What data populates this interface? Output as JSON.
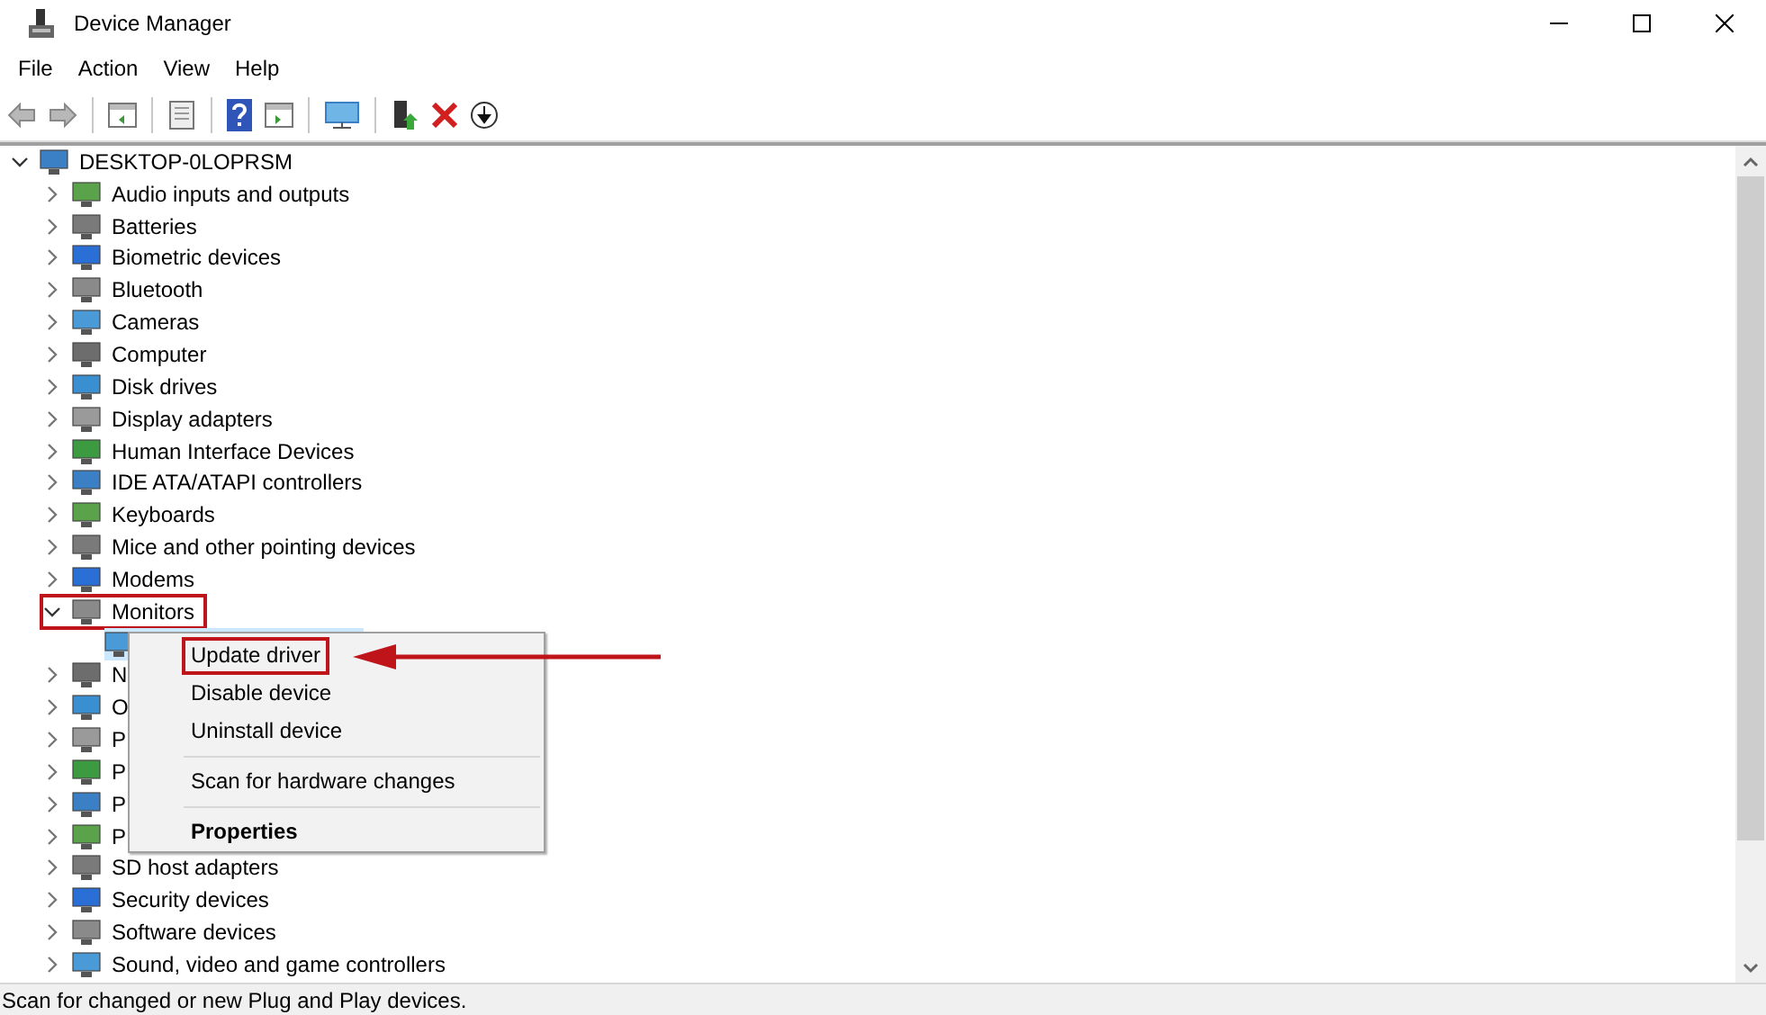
{
  "window": {
    "title": "Device Manager"
  },
  "menu": [
    "File",
    "Action",
    "View",
    "Help"
  ],
  "tree": {
    "label": "DESKTOP-0LOPRSM",
    "expanded": true,
    "selected": false,
    "children": [
      {
        "label": "Audio inputs and outputs",
        "expanded": false,
        "selected": false,
        "callout": false
      },
      {
        "label": "Batteries",
        "expanded": false,
        "selected": false,
        "callout": false
      },
      {
        "label": "Biometric devices",
        "expanded": false,
        "selected": false,
        "callout": false
      },
      {
        "label": "Bluetooth",
        "expanded": false,
        "selected": false,
        "callout": false
      },
      {
        "label": "Cameras",
        "expanded": false,
        "selected": false,
        "callout": false
      },
      {
        "label": "Computer",
        "expanded": false,
        "selected": false,
        "callout": false
      },
      {
        "label": "Disk drives",
        "expanded": false,
        "selected": false,
        "callout": false
      },
      {
        "label": "Display adapters",
        "expanded": false,
        "selected": false,
        "callout": false
      },
      {
        "label": "Human Interface Devices",
        "expanded": false,
        "selected": false,
        "callout": false
      },
      {
        "label": "IDE ATA/ATAPI controllers",
        "expanded": false,
        "selected": false,
        "callout": false
      },
      {
        "label": "Keyboards",
        "expanded": false,
        "selected": false,
        "callout": false
      },
      {
        "label": "Mice and other pointing devices",
        "expanded": false,
        "selected": false,
        "callout": false
      },
      {
        "label": "Modems",
        "expanded": false,
        "selected": false,
        "callout": false
      },
      {
        "label": "Monitors",
        "expanded": true,
        "selected": false,
        "callout": true,
        "children": [
          {
            "selected": true
          }
        ]
      },
      {
        "label": "N",
        "expanded": false,
        "selected": false,
        "callout": false
      },
      {
        "label": "O",
        "expanded": false,
        "selected": false,
        "callout": false
      },
      {
        "label": "P",
        "expanded": false,
        "selected": false,
        "callout": false
      },
      {
        "label": "P",
        "expanded": false,
        "selected": false,
        "callout": false
      },
      {
        "label": "P",
        "expanded": false,
        "selected": false,
        "callout": false
      },
      {
        "label": "P",
        "expanded": false,
        "selected": false,
        "callout": false
      },
      {
        "label": "SD host adapters",
        "expanded": false,
        "selected": false,
        "callout": false
      },
      {
        "label": "Security devices",
        "expanded": false,
        "selected": false,
        "callout": false
      },
      {
        "label": "Software devices",
        "expanded": false,
        "selected": false,
        "callout": false
      },
      {
        "label": "Sound, video and game controllers",
        "expanded": false,
        "selected": false,
        "callout": false
      }
    ]
  },
  "context_menu": {
    "items": [
      {
        "kind": "item",
        "label": "Update driver",
        "default": false,
        "callout": true
      },
      {
        "kind": "item",
        "label": "Disable device",
        "default": false,
        "callout": false
      },
      {
        "kind": "item",
        "label": "Uninstall device",
        "default": false,
        "callout": false
      },
      {
        "kind": "separator"
      },
      {
        "kind": "item",
        "label": "Scan for hardware changes",
        "default": false,
        "callout": false
      },
      {
        "kind": "separator"
      },
      {
        "kind": "item",
        "label": "Properties",
        "default": true,
        "callout": false
      }
    ]
  },
  "status_bar": "Scan for changed or new Plug and Play devices."
}
